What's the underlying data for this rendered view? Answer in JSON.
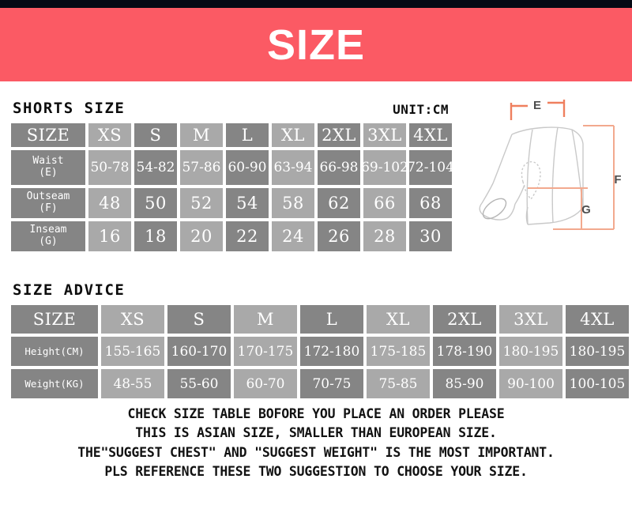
{
  "banner": {
    "title": "SIZE",
    "bg_color": "#fb5a64",
    "text_color": "#ffffff",
    "top_strip_color": "#050914"
  },
  "palette": {
    "cell_dark": "#858585",
    "cell_light": "#a9a9a9",
    "accent_orange": "#ef7f5e",
    "accent_orange_light": "#f2a98e",
    "outline_gray": "#c9c9c9"
  },
  "shorts_size": {
    "caption": "SHORTS SIZE",
    "unit_label": "UNIT:CM",
    "columns": [
      "SIZE",
      "XS",
      "S",
      "M",
      "L",
      "XL",
      "2XL",
      "3XL",
      "4XL"
    ],
    "rows": [
      {
        "label_line1": "Waist",
        "label_line2": "(E)",
        "values": [
          "50-78",
          "54-82",
          "57-86",
          "60-90",
          "63-94",
          "66-98",
          "69-102",
          "72-104"
        ]
      },
      {
        "label_line1": "Outseam",
        "label_line2": "(F)",
        "values": [
          "48",
          "50",
          "52",
          "54",
          "58",
          "62",
          "66",
          "68"
        ]
      },
      {
        "label_line1": "Inseam",
        "label_line2": "(G)",
        "values": [
          "16",
          "18",
          "20",
          "22",
          "24",
          "26",
          "28",
          "30"
        ]
      }
    ]
  },
  "size_advice": {
    "caption": "SIZE ADVICE",
    "columns": [
      "SIZE",
      "XS",
      "S",
      "M",
      "L",
      "XL",
      "2XL",
      "3XL",
      "4XL"
    ],
    "rows": [
      {
        "label": "Height(CM)",
        "values": [
          "155-165",
          "160-170",
          "170-175",
          "172-180",
          "175-185",
          "178-190",
          "180-195",
          "180-195"
        ]
      },
      {
        "label": "Weight(KG)",
        "values": [
          "48-55",
          "55-60",
          "60-70",
          "70-75",
          "75-85",
          "85-90",
          "90-100",
          "100-105"
        ]
      }
    ]
  },
  "illustration": {
    "name": "cycling-shorts-diagram",
    "dimension_labels": {
      "waist": "E",
      "outseam": "F",
      "inseam": "G"
    }
  },
  "footer": {
    "lines": [
      "CHECK SIZE TABLE BOFORE YOU PLACE AN ORDER PLEASE",
      "THIS IS ASIAN SIZE, SMALLER THAN EUROPEAN SIZE.",
      "THE\"SUGGEST CHEST\" AND \"SUGGEST WEIGHT\" IS THE MOST IMPORTANT.",
      "PLS REFERENCE THESE TWO SUGGESTION TO CHOOSE YOUR SIZE."
    ]
  }
}
